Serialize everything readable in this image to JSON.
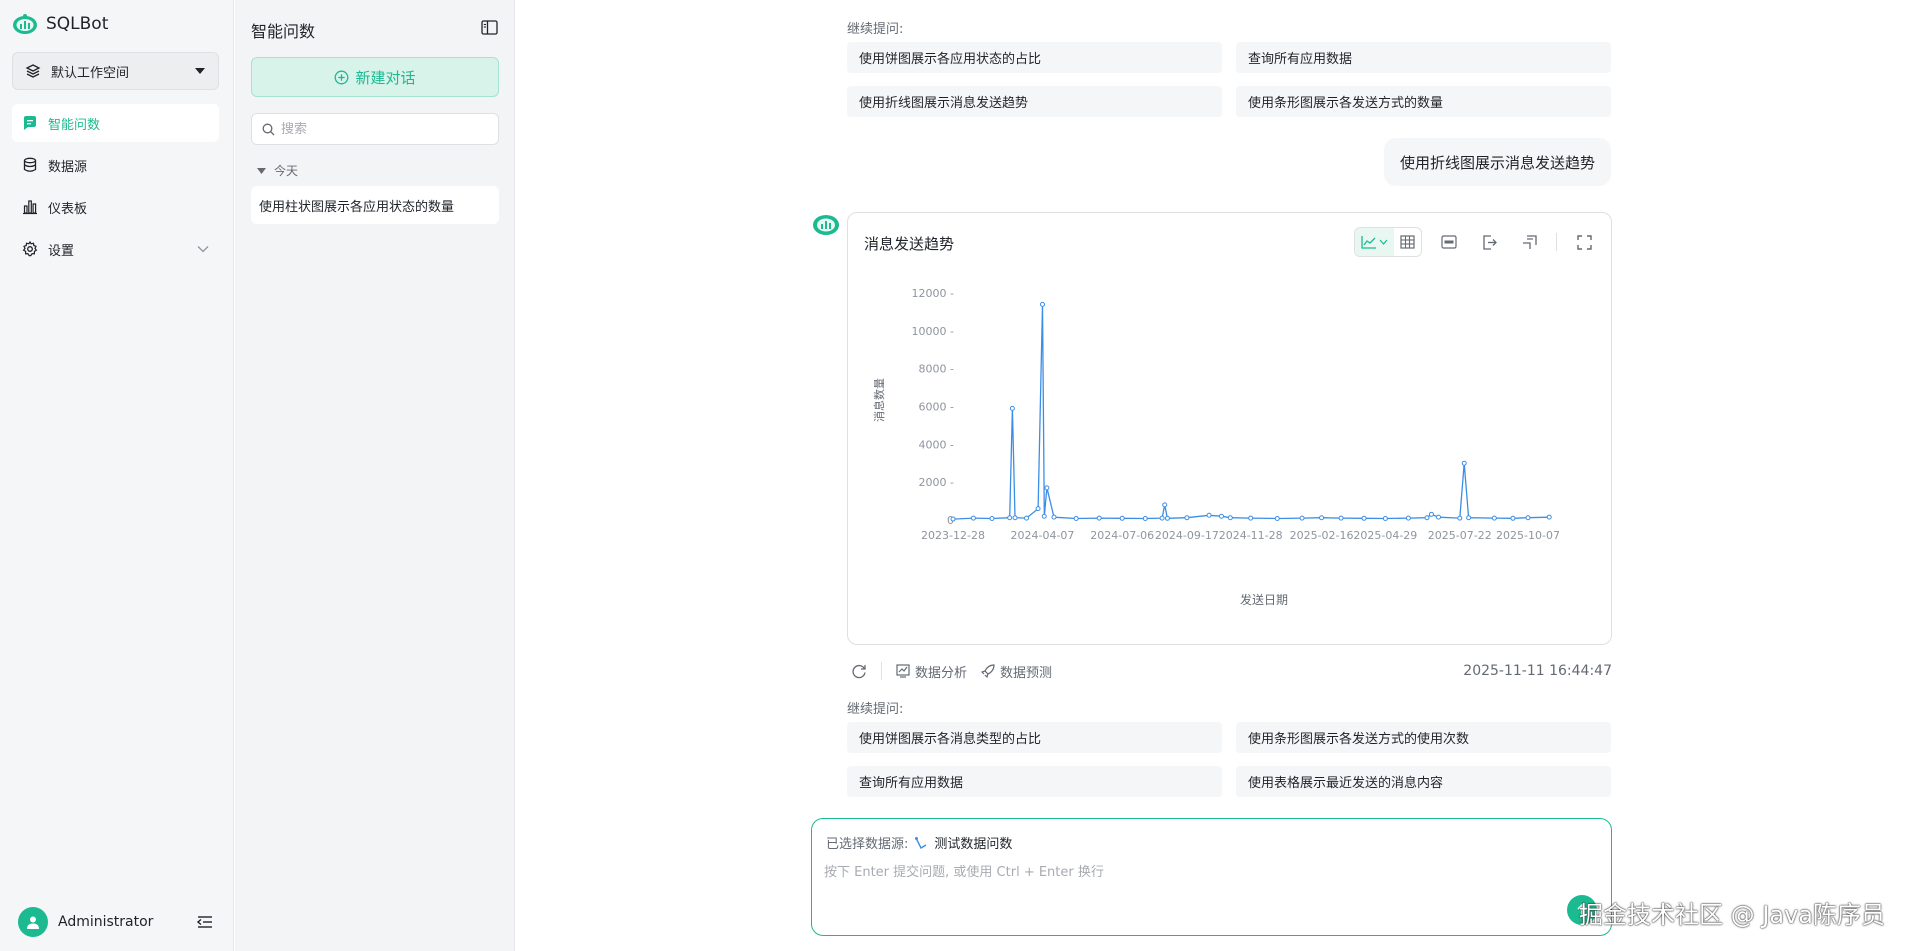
{
  "brand": {
    "name": "SQLBot"
  },
  "workspace": {
    "label": "默认工作空间"
  },
  "nav": {
    "items": [
      {
        "label": "智能问数",
        "icon": "chat-bubble-icon",
        "active": true
      },
      {
        "label": "数据源",
        "icon": "database-icon"
      },
      {
        "label": "仪表板",
        "icon": "bar-chart-icon"
      },
      {
        "label": "设置",
        "icon": "gear-icon"
      }
    ]
  },
  "user": {
    "name": "Administrator"
  },
  "conversations": {
    "title": "智能问数",
    "new_chat": "新建对话",
    "search_placeholder": "搜索",
    "group_label": "今天",
    "items": [
      {
        "label": "使用柱状图展示各应用状态的数量"
      }
    ]
  },
  "top_followups": {
    "label": "继续提问:",
    "chips": [
      "使用饼图展示各应用状态的占比",
      "查询所有应用数据",
      "使用折线图展示消息发送趋势",
      "使用条形图展示各发送方式的数量"
    ]
  },
  "user_message": "使用折线图展示消息发送趋势",
  "chart_card": {
    "title": "消息发送趋势",
    "accent": "#1cba90",
    "line_color": "#3b8ee6"
  },
  "chart_data": {
    "type": "line",
    "title": "消息发送趋势",
    "xlabel": "发送日期",
    "ylabel": "消息数量",
    "ylim": [
      0,
      12000
    ],
    "yticks": [
      "0",
      "2000 -",
      "4000 -",
      "6000 -",
      "8000 -",
      "10000 -",
      "12000 -"
    ],
    "xticks": [
      "2023-12-28",
      "2024-04-07",
      "2024-07-06",
      "2024-09-17",
      "2024-11-28",
      "2025-02-16",
      "2025-04-29",
      "2025-07-22",
      "2025-10-07"
    ],
    "grid": false,
    "series": [
      {
        "x": [
          "2023-12-28",
          "2024-01-20",
          "2024-02-10",
          "2024-03-01",
          "2024-03-04",
          "2024-03-07",
          "2024-03-20",
          "2024-04-02",
          "2024-04-07",
          "2024-04-09",
          "2024-04-12",
          "2024-04-20",
          "2024-05-15",
          "2024-06-10",
          "2024-07-06",
          "2024-08-01",
          "2024-08-20",
          "2024-08-23",
          "2024-08-26",
          "2024-09-17",
          "2024-10-12",
          "2024-10-26",
          "2024-11-05",
          "2024-11-28",
          "2024-12-28",
          "2025-01-25",
          "2025-02-16",
          "2025-03-10",
          "2025-04-05",
          "2025-04-29",
          "2025-05-25",
          "2025-06-15",
          "2025-06-20",
          "2025-06-28",
          "2025-07-22",
          "2025-07-27",
          "2025-08-01",
          "2025-08-30",
          "2025-09-20",
          "2025-10-07",
          "2025-10-31"
        ],
        "values": [
          50,
          100,
          80,
          120,
          5900,
          120,
          100,
          600,
          11400,
          200,
          1700,
          150,
          80,
          100,
          90,
          80,
          100,
          800,
          90,
          120,
          250,
          200,
          120,
          100,
          80,
          100,
          120,
          100,
          90,
          80,
          100,
          120,
          300,
          150,
          100,
          3000,
          120,
          100,
          90,
          120,
          150
        ]
      }
    ]
  },
  "actions": {
    "analysis": "数据分析",
    "predict": "数据预测",
    "timestamp": "2025-11-11 16:44:47"
  },
  "bottom_followups": {
    "label": "继续提问:",
    "chips": [
      "使用饼图展示各消息类型的占比",
      "使用条形图展示各发送方式的使用次数",
      "查询所有应用数据",
      "使用表格展示最近发送的消息内容"
    ]
  },
  "input": {
    "ds_label": "已选择数据源:",
    "ds_name": "测试数据问数",
    "placeholder": "按下 Enter 提交问题, 或使用 Ctrl + Enter 换行"
  },
  "watermark": "掘金技术社区 @ Java陈序员"
}
